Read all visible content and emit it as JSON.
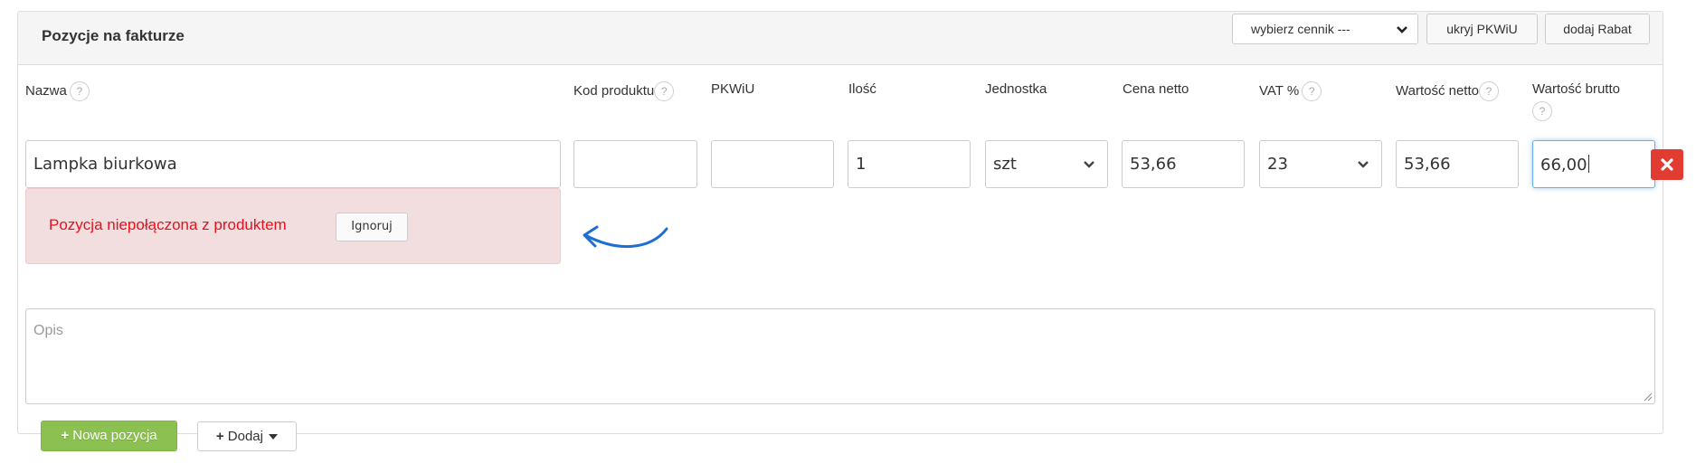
{
  "panel": {
    "title": "Pozycje na fakturze",
    "pricelist_select": "wybierz cennik ---",
    "hide_pkwiu_label": "ukryj PKWiU",
    "add_discount_label": "dodaj Rabat"
  },
  "columns": {
    "name": "Nazwa",
    "product_code": "Kod produktu",
    "pkwiu": "PKWiU",
    "quantity": "Ilość",
    "unit": "Jednostka",
    "net_price": "Cena netto",
    "vat": "VAT %",
    "net_value": "Wartość netto",
    "gross_value": "Wartość brutto",
    "help_glyph": "?"
  },
  "row": {
    "name": "Lampka biurkowa",
    "product_code": "",
    "pkwiu": "",
    "quantity": "1",
    "unit": "szt",
    "net_price": "53,66",
    "vat": "23",
    "net_value": "53,66",
    "gross_value": "66,00"
  },
  "alert": {
    "message": "Pozycja niepołączona z produktem",
    "ignore_label": "Ignoruj"
  },
  "description": {
    "placeholder": "Opis"
  },
  "footer": {
    "new_item_label": "Nowa pozycja",
    "add_label": "Dodaj"
  },
  "icons": {
    "delete": "close-icon",
    "help": "help-icon",
    "plus": "plus-icon",
    "dropdown": "caret-down-icon",
    "arrow": "curved-arrow-icon"
  },
  "colors": {
    "danger": "#e03c31",
    "alert_bg": "#f2dede",
    "alert_text": "#e8101b",
    "success": "#8cc152",
    "focus": "#66afe9",
    "arrow": "#1f6ed4"
  }
}
